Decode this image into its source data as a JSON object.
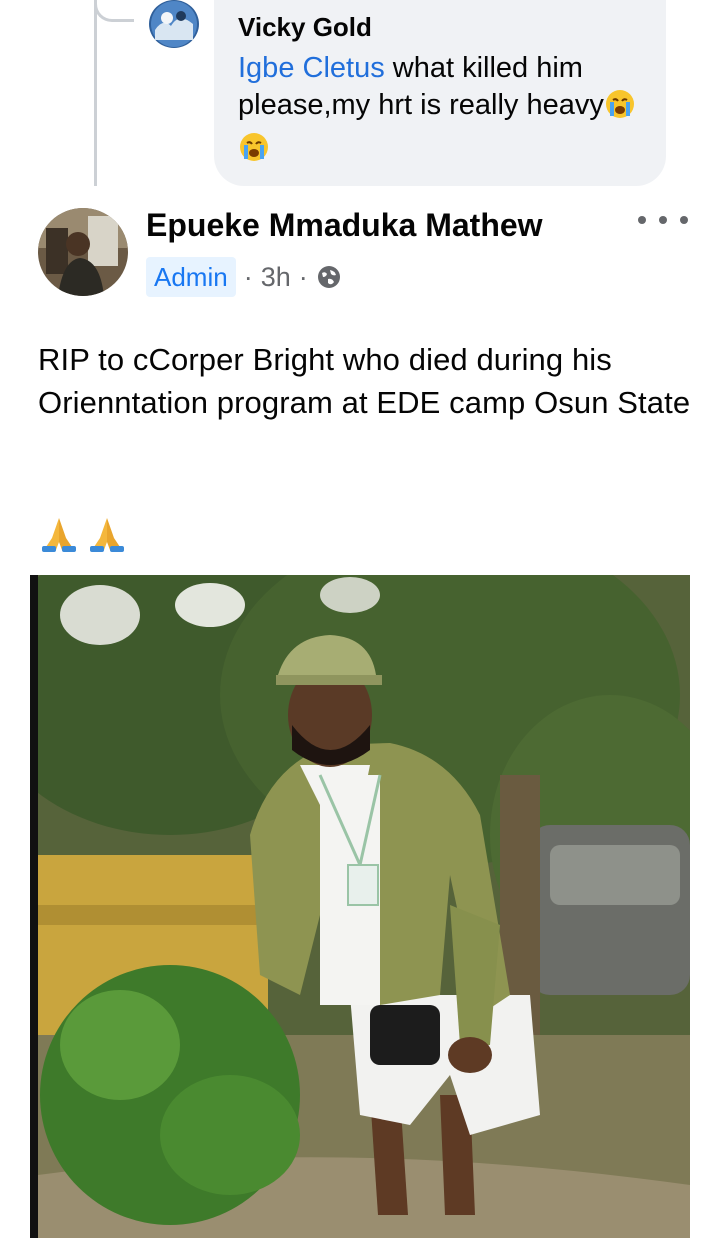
{
  "comment": {
    "author": "Vicky Gold",
    "mention": "Igbe Cletus",
    "text_part1": " what killed him please,my hrt is really heavy",
    "emojis": [
      "crying-face-icon",
      "crying-face-icon"
    ]
  },
  "post": {
    "author": "Epueke Mmaduka Mathew",
    "role_badge": "Admin",
    "separator": "·",
    "time": "3h",
    "privacy_icon": "globe-icon",
    "more_icon": "more-options-icon",
    "text": "RIP to cCorper Bright who died during his Orienntation program at EDE camp Osun State",
    "reaction_emojis": [
      "folded-hands-icon",
      "folded-hands-icon"
    ]
  },
  "colors": {
    "mention": "#216fdb",
    "badge_bg": "#e7f3ff",
    "badge_text": "#1877f2",
    "meta_gray": "#65676b",
    "bubble_bg": "#f0f2f5"
  }
}
